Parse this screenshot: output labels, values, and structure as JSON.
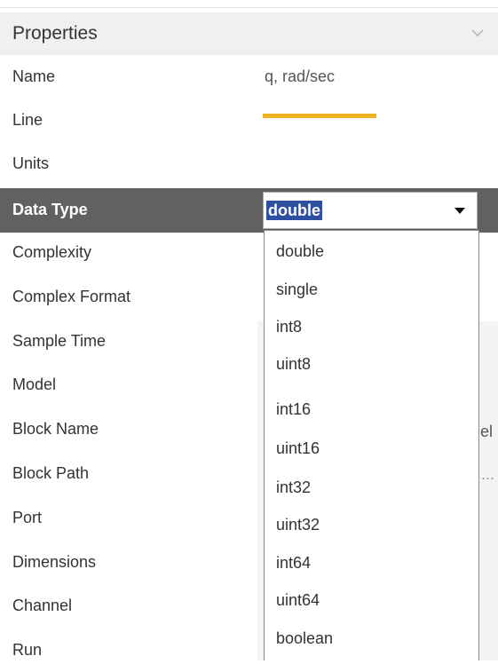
{
  "panel": {
    "title": "Properties",
    "icons": {
      "collapse": "chevron-down-icon"
    }
  },
  "rows": [
    {
      "label": "Name",
      "value": "q, rad/sec"
    },
    {
      "label": "Line",
      "value": ""
    },
    {
      "label": "Units",
      "value": ""
    },
    {
      "label": "Data Type",
      "value": "double"
    },
    {
      "label": "Complexity",
      "value": ""
    },
    {
      "label": "Complex Format",
      "value": ""
    },
    {
      "label": "Sample Time",
      "value": ""
    },
    {
      "label": "Model",
      "value": ""
    },
    {
      "label": "Block Name",
      "value": "el"
    },
    {
      "label": "Block Path",
      "value": "..."
    },
    {
      "label": "Port",
      "value": ""
    },
    {
      "label": "Dimensions",
      "value": ""
    },
    {
      "label": "Channel",
      "value": ""
    },
    {
      "label": "Run",
      "value": ""
    }
  ],
  "line_color": "#f0b323",
  "selected_row_color": "#616161",
  "data_type_select": {
    "selected": "double",
    "options": [
      "double",
      "single",
      "int8",
      "uint8",
      "int16",
      "uint16",
      "int32",
      "uint32",
      "int64",
      "uint64",
      "boolean"
    ]
  }
}
